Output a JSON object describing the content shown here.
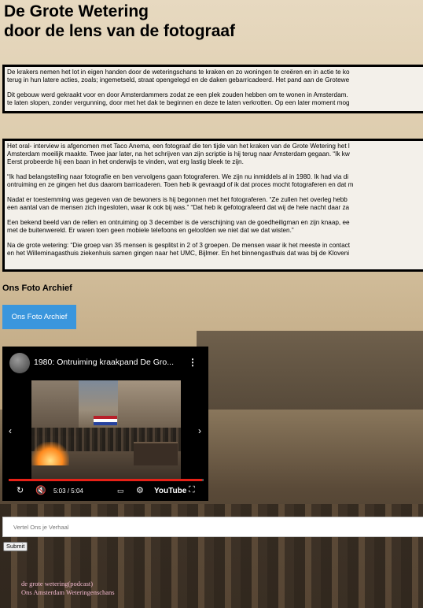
{
  "page": {
    "title_line1": "De Grote Wetering",
    "title_line2": "door de lens van de fotograaf"
  },
  "intro_box": {
    "paragraphs": [
      "De krakers nemen het lot in eigen handen door de weteringschans te kraken en zo woningen te creëren en in actie te ko",
      "terug in hun latere acties, zoals; ingemetseld, straat opengelegd en de daken gebarricadeerd. Het pand aan de Grotewe",
      "Dit gebouw werd gekraakt voor en door Amsterdammers zodat ze een plek zouden hebben om te wonen in Amsterdam.",
      "te laten slopen, zonder vergunning, door met het dak te beginnen en deze te laten verkrotten. Op een later moment mog"
    ]
  },
  "interview_box": {
    "paragraphs": [
      "Het oral- interview is afgenomen met Taco Anema, een fotograaf die ten tijde van het kraken van de Grote Wetering het l",
      "Amsterdam moeilijk maakte. Twee jaar later, na het schrijven van zijn scriptie is hij terug naar Amsterdam gegaan. “Ik kw",
      "Eerst probeerde hij een baan in het onderwijs te vinden, wat erg lastig bleek te zijn.",
      "“Ik had belangstelling naar fotografie en ben vervolgens gaan fotograferen. We zijn nu inmiddels al in 1980. Ik had via di",
      "ontruiming en ze gingen het dus daarom barricaderen. Toen heb ik gevraagd of ik dat proces mocht fotograferen en dat m",
      "Nadat er toestemming was gegeven van de bewoners is hij begonnen met het fotograferen. “Ze zullen het overleg hebb",
      "een aantal van de mensen zich ingesloten, waar ik ook bij was.” “Dat heb ik gefotografeerd dat wij de hele nacht daar za",
      "Een bekend beeld van de rellen en ontruiming op 3 december is de verschijning van de goedheiligman en zijn knaap, ee",
      "met de buitenwereld. Er waren toen geen mobiele telefoons en geloofden we niet dat we dat wisten.”",
      "Na de grote wetering: “Die groep van 35 mensen is gesplitst in 2 of 3 groepen. De mensen waar ik het meeste in contact",
      "en het Willeminagasthuis ziekenhuis samen gingen naar het UMC, Bijlmer. En het binnengasthuis dat was bij de Kloveni"
    ]
  },
  "archive": {
    "heading": "Ons Foto Archief",
    "button_label": "Ons Foto Archief"
  },
  "video": {
    "title": "1980: Ontruiming kraakpand De Gro...",
    "time_current": "5:03",
    "time_separator": "/",
    "time_total": "5:04",
    "progress_fraction": 0.99,
    "brand": "YouTube",
    "icons": [
      "more-vert-icon",
      "prev-arrow-icon",
      "next-arrow-icon",
      "replay-icon",
      "mute-icon",
      "captions-icon",
      "settings-icon",
      "fullscreen-icon"
    ]
  },
  "story_form": {
    "placeholder": "Vertel Ons je Verhaal",
    "value": "",
    "submit_label": "Submit"
  },
  "footer": {
    "links": [
      "de grote wetering(podcast)",
      "Ons Amsterdam Weteringenschans"
    ]
  },
  "colors": {
    "button_blue": "#3a96dd",
    "progress_red": "#e62117",
    "link_pink": "#f2b9cf"
  }
}
